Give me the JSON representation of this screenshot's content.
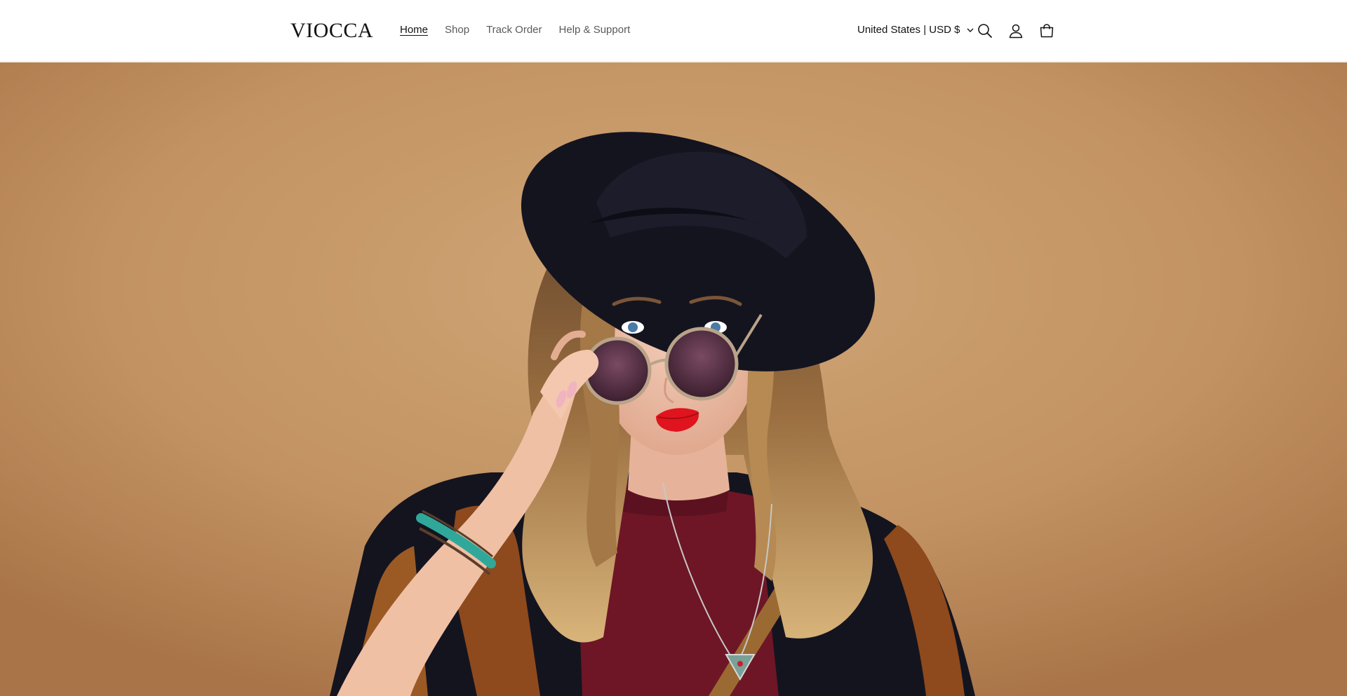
{
  "header": {
    "logo": "VIOCCA",
    "nav": [
      {
        "label": "Home",
        "active": true
      },
      {
        "label": "Shop",
        "active": false
      },
      {
        "label": "Track Order",
        "active": false
      },
      {
        "label": "Help & Support",
        "active": false
      }
    ],
    "locale": "United States | USD $",
    "icons": [
      "search-icon",
      "account-icon",
      "cart-icon"
    ]
  },
  "hero": {
    "image": "woman-in-black-hat-and-sunglasses",
    "colors": {
      "background": "#c59767",
      "hat": "#14141f",
      "sweater": "#6e1626",
      "lips": "#e0141e",
      "bracelet": "#2fa89a"
    }
  }
}
